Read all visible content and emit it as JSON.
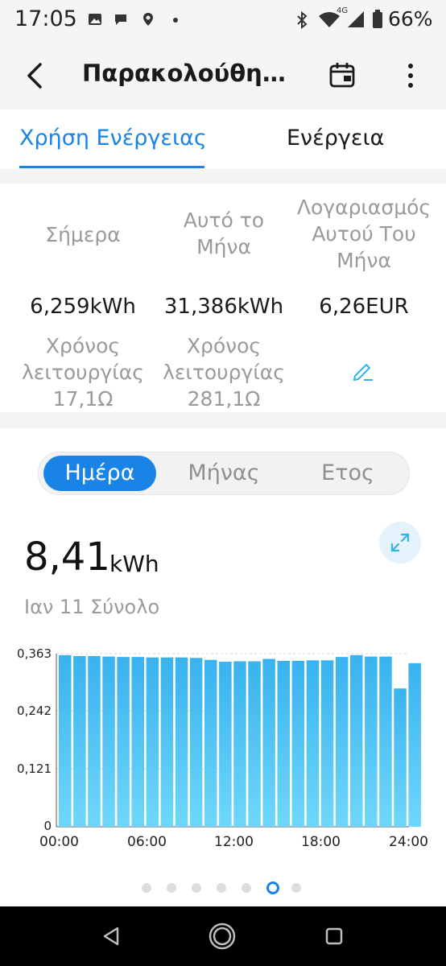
{
  "status_bar": {
    "time": "17:05",
    "network": "4G",
    "battery": "66%"
  },
  "header": {
    "title": "Παρακολούθησ..."
  },
  "tabs": [
    {
      "label": "Χρήση Ενέργειας",
      "active": true
    },
    {
      "label": "Ενέργεια",
      "active": false
    }
  ],
  "stats": {
    "today_label": "Σήμερα",
    "month_label_1": "Αυτό το",
    "month_label_2": "Μήνα",
    "bill_label_1": "Λογαριασμός",
    "bill_label_2": "Αυτού Του",
    "bill_label_3": "Μήνα",
    "today_value": "6,259kWh",
    "month_value": "31,386kWh",
    "bill_value": "6,26EUR",
    "uptime_label_1": "Χρόνος",
    "uptime_label_2": "λειτουργίας",
    "today_uptime": "17,1Ω",
    "month_uptime": "281,1Ω"
  },
  "segment": {
    "day": "Ημέρα",
    "month": "Μήνας",
    "year": "Ετος",
    "selected": "day"
  },
  "summary": {
    "value": "8,41",
    "unit": "kWh",
    "caption": "Ιαν 11 Σύνολο"
  },
  "colors": {
    "accent": "#1a84e6",
    "bar_top": "#39b2ef",
    "bar_bottom": "#6fd7fb"
  },
  "chart_data": {
    "type": "bar",
    "ylim": [
      0,
      0.363
    ],
    "y_ticks": [
      "0",
      "0,121",
      "0,242",
      "0,363"
    ],
    "x_ticks": [
      "00:00",
      "06:00",
      "12:00",
      "18:00",
      "24:00"
    ],
    "values": [
      0.36,
      0.358,
      0.358,
      0.357,
      0.356,
      0.356,
      0.355,
      0.355,
      0.355,
      0.354,
      0.35,
      0.346,
      0.347,
      0.347,
      0.352,
      0.348,
      0.348,
      0.349,
      0.349,
      0.356,
      0.36,
      0.357,
      0.357,
      0.29,
      0.343
    ]
  },
  "pager": {
    "count": 7,
    "active": 5
  }
}
